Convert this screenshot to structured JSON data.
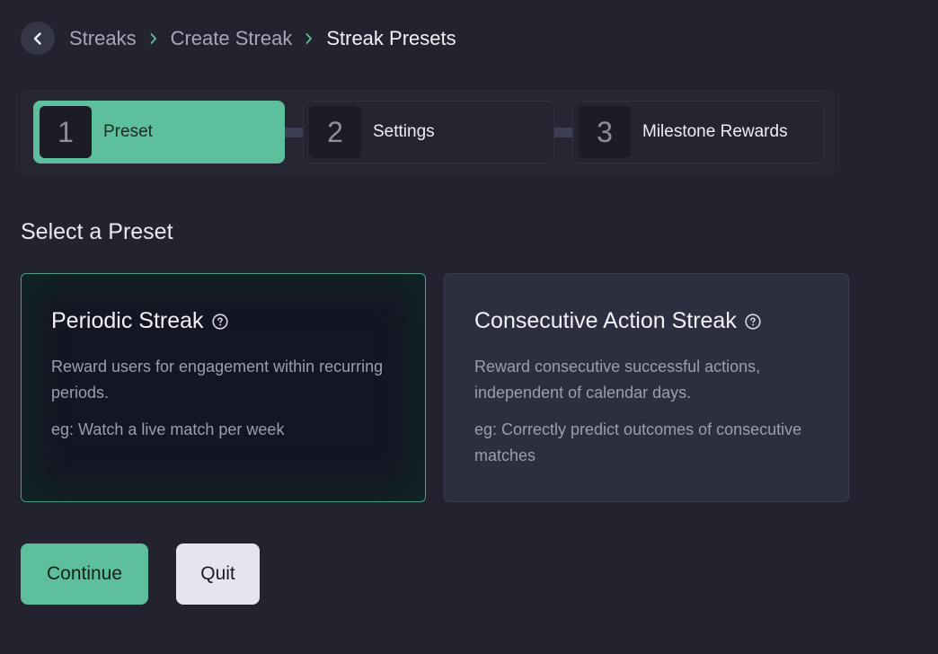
{
  "breadcrumb": {
    "items": [
      {
        "label": "Streaks"
      },
      {
        "label": "Create Streak"
      },
      {
        "label": "Streak Presets"
      }
    ]
  },
  "stepper": {
    "steps": [
      {
        "number": "1",
        "label": "Preset",
        "state": "active"
      },
      {
        "number": "2",
        "label": "Settings",
        "state": "inactive"
      },
      {
        "number": "3",
        "label": "Milestone Rewards",
        "state": "inactive"
      }
    ]
  },
  "section_title": "Select a Preset",
  "presets": [
    {
      "title": "Periodic Streak",
      "description": "Reward users for engagement within recurring periods.",
      "example": "eg: Watch a live match per week",
      "selected": true
    },
    {
      "title": "Consecutive Action Streak",
      "description": "Reward consecutive successful actions, independent of calendar days.",
      "example": "eg: Correctly predict outcomes of consecutive matches",
      "selected": false
    }
  ],
  "actions": {
    "continue_label": "Continue",
    "quit_label": "Quit"
  },
  "colors": {
    "background": "#22232f",
    "accent": "#5ebf9c",
    "card_selected_border": "#4f9b84",
    "card_unselected_bg": "#2d2e40"
  },
  "icons": {
    "back": "chevron-left-icon",
    "separator": "chevron-right-icon",
    "help": "question-circle-icon"
  }
}
